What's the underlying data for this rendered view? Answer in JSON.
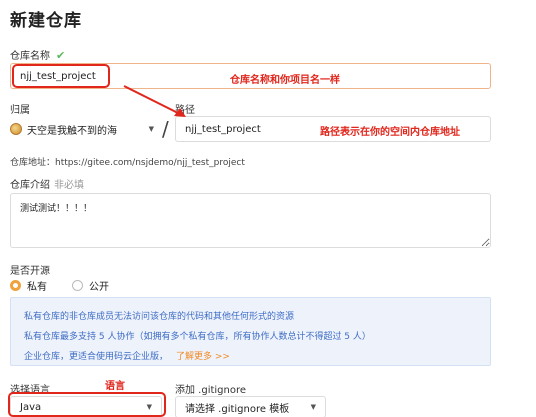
{
  "page_title": "新建仓库",
  "repo_name": {
    "label": "仓库名称",
    "value": "njj_test_project",
    "annotation": "仓库名称和你项目名一样"
  },
  "owner": {
    "label": "归属",
    "value": "天空是我触不到的海"
  },
  "path": {
    "label": "路径",
    "value": "njj_test_project",
    "annotation": "路径表示在你的空间内仓库地址",
    "separator": "/"
  },
  "address": {
    "text": "仓库地址：https://gitee.com/nsjdemo/njj_test_project"
  },
  "description": {
    "label": "仓库介绍",
    "hint": "非必填",
    "value": "测试测试！！！！"
  },
  "visibility": {
    "label": "是否开源",
    "options": [
      {
        "label": "私有",
        "selected": true
      },
      {
        "label": "公开",
        "selected": false
      }
    ]
  },
  "notice": {
    "line1": "私有仓库的非仓库成员无法访问该仓库的代码和其他任何形式的资源",
    "line2": "私有仓库最多支持 5 人协作（如拥有多个私有仓库，所有协作人数总计不得超过 5 人）",
    "line3": "企业仓库，更适合使用码云企业版，",
    "link": "了解更多 >>"
  },
  "language": {
    "label": "选择语言",
    "annotation": "语言",
    "value": "Java"
  },
  "gitignore": {
    "label": "添加 .gitignore",
    "value": "请选择 .gitignore 模板"
  },
  "colors": {
    "annotation_red": "#e1261c",
    "accent_orange": "#f0a23c",
    "notice_blue": "#3f6cc5",
    "check_green": "#5cb85c"
  }
}
